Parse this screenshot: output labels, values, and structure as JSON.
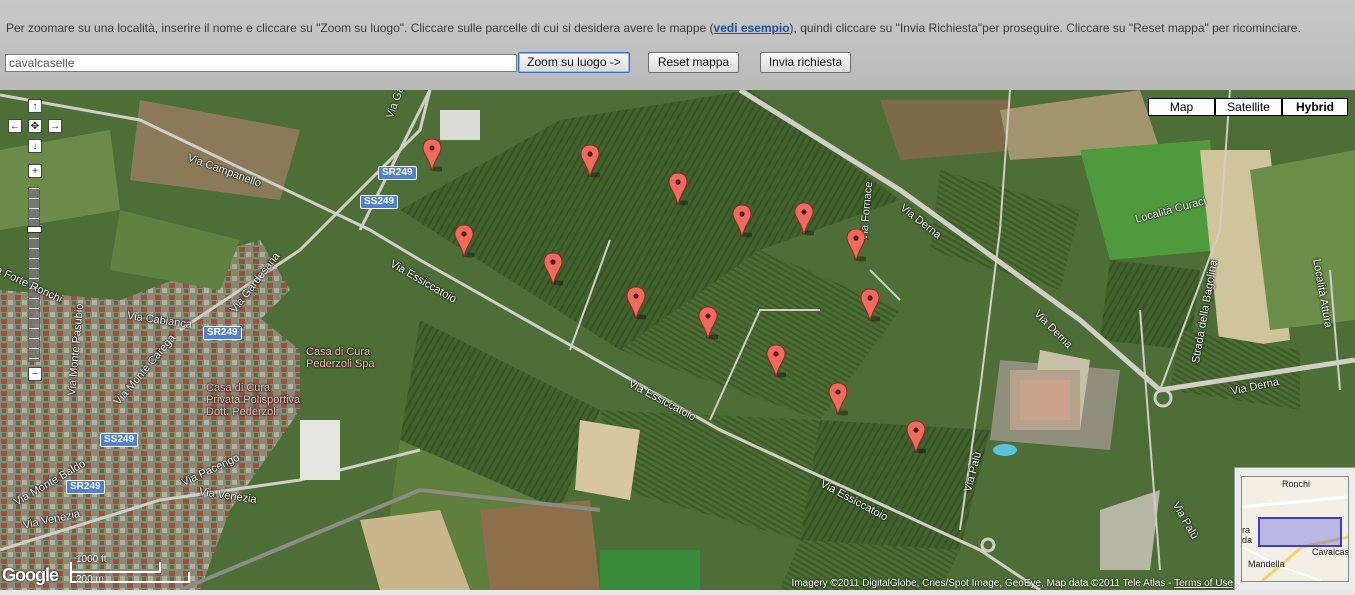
{
  "instructions": {
    "before": "Per zoomare su una località, inserire il nome e cliccare su \"Zoom su luogo\". Cliccare sulle parcelle di cui si desidera avere le mappe (",
    "link": "vedi esempio",
    "after": "), quindi cliccare su \"Invia Richiesta\"per proseguire. Cliccare su \"Reset mappa\" per ricominciare."
  },
  "search": {
    "value": "cavalcaselle"
  },
  "buttons": {
    "zoom": "Zoom su luogo ->",
    "reset": "Reset mappa",
    "send": "Invia richiesta"
  },
  "map_types": {
    "map": "Map",
    "satellite": "Satellite",
    "hybrid": "Hybrid",
    "active": "Hybrid"
  },
  "nav": {
    "up": "↑",
    "left": "←",
    "center": "✥",
    "right": "→",
    "down": "↓",
    "zoom_in": "+",
    "zoom_out": "−"
  },
  "streets": {
    "via_gardesana_1": "Via Gardesana",
    "via_gardesana_2": "Via Gardesana",
    "via_campanello": "Via Campanello",
    "via_forte_ronchi": "Via Forte Ronchi",
    "via_cabianca": "Via Cabianca",
    "via_monte_pasubio": "Via Monte Pasubio",
    "via_monte_carega": "Via Monte Carega",
    "via_monte_baldo": "Via Monte Baldo",
    "via_venezia_1": "Via Venezia",
    "via_venezia_2": "Via Venezia",
    "via_pacengo": "Via Pacengo",
    "via_essiccatoio_1": "Via Essiccatoio",
    "via_essiccatoio_2": "Via Essiccatoio",
    "via_essiccatoio_3": "Via Essiccatoio",
    "via_fornace": "Via Fornace",
    "via_derna_1": "Via Derna",
    "via_derna_2": "Via Derna",
    "via_derna_3": "Via Derna",
    "localita_curaci": "Località Curaci",
    "strada_bagolina": "Strada della Bagolina",
    "localita_attura": "Località Attura",
    "via_palu_1": "Via Palù",
    "via_palu_2": "Via Palù"
  },
  "shields": {
    "sr249_a": "SR249",
    "ss249_a": "SS249",
    "sr249_b": "SR249",
    "ss249_b": "SS249",
    "sr249_c": "SR249"
  },
  "poi": {
    "casa_cura_1": "Casa di Cura\nPederzoli Spa",
    "casa_cura_2": "Casa di Cura\nPrivata Polisportiva\nDott. Pederzoli"
  },
  "scale": {
    "ft": "1000 ft",
    "m": "200 m"
  },
  "copyright": {
    "text": "Imagery ©2011 DigitalGlobe, Cnes/Spot Image, GeoEye, Map data ©2011 Tele Atlas - ",
    "terms": "Terms of Use"
  },
  "google_logo": "Google",
  "overview": {
    "ronchi": "Ronchi",
    "cavalcaselle": "Cavalcaselle",
    "mandella": "Mandella",
    "side": "ra\nda"
  },
  "colors": {
    "marker": "#f06a5e",
    "field_dark": "#3f5f2a",
    "field_mid": "#587a3c",
    "road": "#cfcfc6"
  },
  "markers_count": 17
}
